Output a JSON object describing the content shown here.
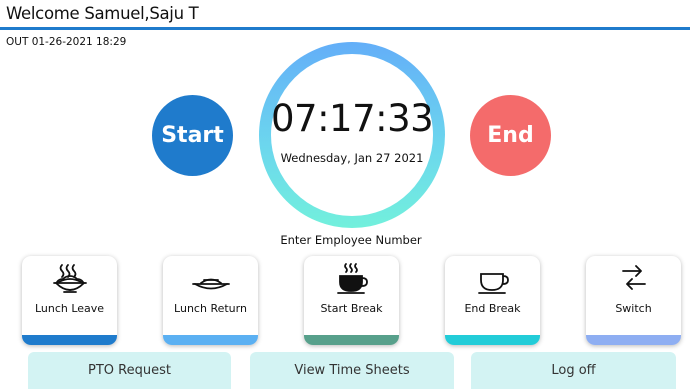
{
  "header": {
    "title": "Welcome Samuel,Saju T",
    "accent_color": "#1f7bcc"
  },
  "status": {
    "text": "OUT 01-26-2021 18:29"
  },
  "clock": {
    "time": "07:17:33",
    "date": "Wednesday, Jan 27 2021"
  },
  "controls": {
    "start_label": "Start",
    "start_color": "#1f7bcc",
    "end_label": "End",
    "end_color": "#f46b6b"
  },
  "employee": {
    "prompt": "Enter Employee Number"
  },
  "tiles": [
    {
      "label": "Lunch Leave",
      "icon": "steaming-noodle-bowl-icon",
      "bar_color": "#1f7bcc"
    },
    {
      "label": "Lunch Return",
      "icon": "empty-plate-icon",
      "bar_color": "#5bb0f2"
    },
    {
      "label": "Start Break",
      "icon": "steaming-cup-icon",
      "bar_color": "#57a08b"
    },
    {
      "label": "End Break",
      "icon": "empty-cup-icon",
      "bar_color": "#22ccd8"
    },
    {
      "label": "Switch",
      "icon": "swap-arrows-icon",
      "bar_color": "#8eaef2"
    }
  ],
  "actions": [
    {
      "label": "PTO Request"
    },
    {
      "label": "View Time Sheets"
    },
    {
      "label": "Log off"
    }
  ]
}
